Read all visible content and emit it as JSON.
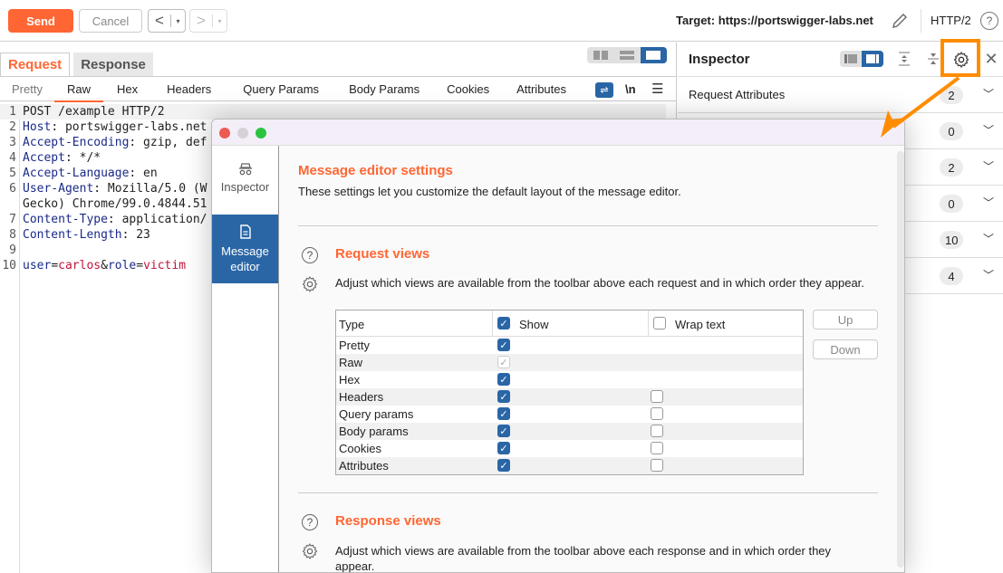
{
  "toolbar": {
    "send_label": "Send",
    "cancel_label": "Cancel",
    "back_arrow": "<",
    "forward_arrow": ">",
    "dropdown_glyph": "▾",
    "target_label": "Target: https://portswigger-labs.net",
    "protocol": "HTTP/2",
    "help_glyph": "?"
  },
  "editor": {
    "tabs": [
      {
        "label": "Request",
        "active": true
      },
      {
        "label": "Response",
        "active": false
      }
    ],
    "sub_tabs": [
      "Pretty",
      "Raw",
      "Hex",
      "Headers",
      "Query Params",
      "Body Params",
      "Cookies",
      "Attributes"
    ],
    "active_sub_tab": "Raw",
    "newline_label": "\\n",
    "menu_glyph": "☰",
    "lines": [
      {
        "n": "1",
        "key": "",
        "val": "POST /example HTTP/2"
      },
      {
        "n": "2",
        "key": "Host",
        "val": ": portswigger-labs.net"
      },
      {
        "n": "3",
        "key": "Accept-Encoding",
        "val": ": gzip, def"
      },
      {
        "n": "4",
        "key": "Accept",
        "val": ": */*"
      },
      {
        "n": "5",
        "key": "Accept-Language",
        "val": ": en"
      },
      {
        "n": "6",
        "key": "User-Agent",
        "val": ": Mozilla/5.0 (W"
      },
      {
        "n": "",
        "key": "",
        "val": "Gecko) Chrome/99.0.4844.51"
      },
      {
        "n": "7",
        "key": "Content-Type",
        "val": ": application/"
      },
      {
        "n": "8",
        "key": "Content-Length",
        "val": ": 23"
      },
      {
        "n": "9",
        "key": "",
        "val": ""
      },
      {
        "n": "10",
        "key": "",
        "val": ""
      }
    ],
    "body": {
      "k1": "user",
      "v1": "carlos",
      "amp": "&",
      "k2": "role",
      "v2": "victim",
      "eq": "="
    }
  },
  "inspector": {
    "title": "Inspector",
    "rows": [
      {
        "label": "Request Attributes",
        "count": "2"
      },
      {
        "label": "",
        "count": "0"
      },
      {
        "label": "",
        "count": "2"
      },
      {
        "label": "",
        "count": "0"
      },
      {
        "label": "",
        "count": "10"
      },
      {
        "label": "",
        "count": "4"
      }
    ],
    "close_glyph": "✕",
    "chevron_glyph": "⌄"
  },
  "dialog": {
    "sidebar": [
      {
        "label": "Inspector",
        "active": false
      },
      {
        "label": "Message editor",
        "active": true
      }
    ],
    "heading": "Message editor settings",
    "description": "These settings let you customize the default layout of the message editor.",
    "request_views": {
      "title": "Request views",
      "description": "Adjust which views are available from the toolbar above each request and in which order they appear.",
      "columns": {
        "type": "Type",
        "show": "Show",
        "wrap": "Wrap text"
      },
      "header_show_checked": true,
      "header_wrap_checked": false,
      "rows": [
        {
          "type": "Pretty",
          "show": "on",
          "wrap": "none"
        },
        {
          "type": "Raw",
          "show": "disabled",
          "wrap": "none"
        },
        {
          "type": "Hex",
          "show": "on",
          "wrap": "none"
        },
        {
          "type": "Headers",
          "show": "on",
          "wrap": "off"
        },
        {
          "type": "Query params",
          "show": "on",
          "wrap": "off"
        },
        {
          "type": "Body params",
          "show": "on",
          "wrap": "off"
        },
        {
          "type": "Cookies",
          "show": "on",
          "wrap": "off"
        },
        {
          "type": "Attributes",
          "show": "on",
          "wrap": "off"
        }
      ],
      "up_label": "Up",
      "down_label": "Down"
    },
    "response_views": {
      "title": "Response views",
      "description": "Adjust which views are available from the toolbar above each response and in which order they appear."
    }
  },
  "colors": {
    "accent": "#ff6633",
    "selected": "#2a66a6",
    "highlight": "#ff8c00"
  }
}
